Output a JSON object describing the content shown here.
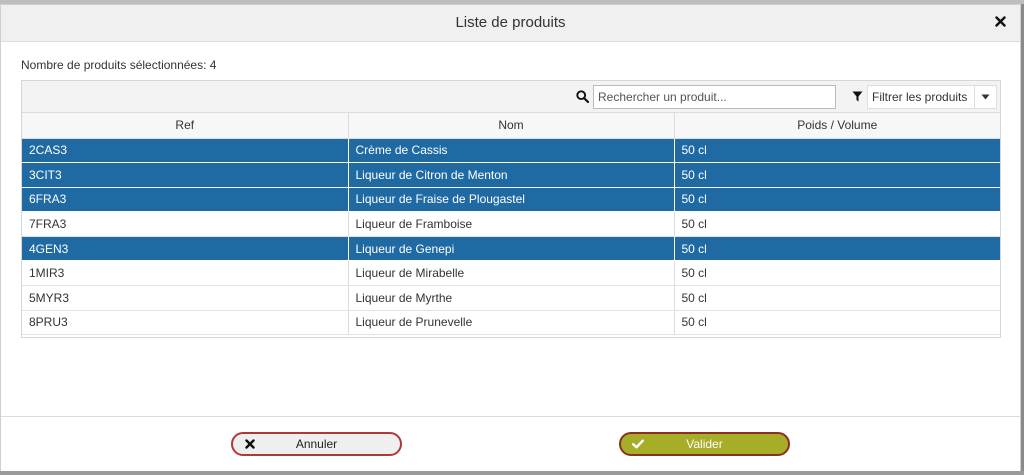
{
  "modal": {
    "title": "Liste de produits",
    "selected_count_text": "Nombre de produits sélectionnées: 4"
  },
  "toolbar": {
    "search_placeholder": "Rechercher un produit...",
    "filter_label": "Filtrer les produits"
  },
  "table": {
    "columns": [
      "Ref",
      "Nom",
      "Poids / Volume"
    ],
    "rows": [
      {
        "ref": "2CAS3",
        "nom": "Crème de Cassis",
        "poids": "50 cl",
        "selected": true
      },
      {
        "ref": "3CIT3",
        "nom": "Liqueur de Citron de Menton",
        "poids": "50 cl",
        "selected": true
      },
      {
        "ref": "6FRA3",
        "nom": "Liqueur de Fraise de Plougastel",
        "poids": "50 cl",
        "selected": true
      },
      {
        "ref": "7FRA3",
        "nom": "Liqueur de Framboise",
        "poids": "50 cl",
        "selected": false
      },
      {
        "ref": "4GEN3",
        "nom": "Liqueur de Genepi",
        "poids": "50 cl",
        "selected": true
      },
      {
        "ref": "1MIR3",
        "nom": "Liqueur de Mirabelle",
        "poids": "50 cl",
        "selected": false
      },
      {
        "ref": "5MYR3",
        "nom": "Liqueur de Myrthe",
        "poids": "50 cl",
        "selected": false
      },
      {
        "ref": "8PRU3",
        "nom": "Liqueur de Prunevelle",
        "poids": "50 cl",
        "selected": false
      }
    ]
  },
  "footer": {
    "cancel_label": "Annuler",
    "ok_label": "Valider"
  },
  "colors": {
    "selected_row": "#1f6aa3",
    "ok_button": "#a6ad27",
    "button_border": "#b03838"
  },
  "icons": {
    "close": "close-icon",
    "search": "search-icon",
    "filter": "filter-icon",
    "caret": "caret-down-icon",
    "cancel": "x-icon",
    "ok": "check-icon"
  }
}
